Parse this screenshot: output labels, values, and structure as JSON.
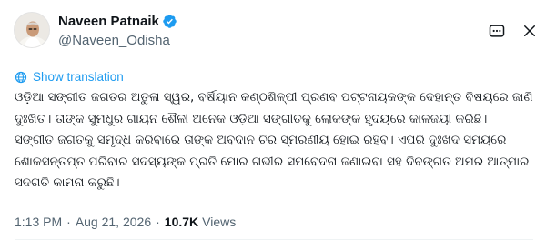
{
  "author": {
    "display_name": "Naveen Patnaik",
    "handle": "@Naveen_Odisha",
    "verified": true
  },
  "icons": {
    "avatar": "profile-photo",
    "verified": "verified-badge-icon",
    "more": "more-icon",
    "close": "close-icon",
    "translate": "globe-icon"
  },
  "colors": {
    "accent": "#1d9bf0",
    "muted_text": "#536471",
    "text": "#0f1419"
  },
  "translation": {
    "label": "Show translation"
  },
  "post": {
    "lines": [
      "ଓଡ଼ିଆ ସଙ୍ଗୀତ ଜଗତର ଅତୁଳା ସ୍ୱର, ବର୍ଷିୟାନ କଣ୍ଠଶିଳ୍ପୀ ପ୍ରଣବ ପଟ୍ଟନାୟକଙ୍କ ଦେହାନ୍ତ ବିଷୟରେ ଜାଣି ମୁଁ",
      "ଦୁଃଖିତ। ତାଙ୍କ ସୁମଧୁର ଗାୟନ ଶୈଳୀ ଅନେକ ଓଡ଼ିଆ ସଙ୍ଗୀତକୁ ଲୋକଙ୍କ ହୃଦୟରେ କାଳଜୟୀ କରିଛି।",
      "ସଙ୍ଗୀତ ଜଗତକୁ ସମୃଦ୍ଧ କରିବାରେ ତାଙ୍କ ଅବଦାନ ଚିର ସ୍ମରଣୀୟ ହୋଇ ରହିବ। ଏପରି ଦୁଃଖଦ ସମୟରେ",
      "ଶୋକସନ୍ତପ୍ତ ପରିବାର ସଦସ୍ୟଙ୍କ ପ୍ରତି ମୋର ଗଭୀର ସମବେଦନା ଜଣାଇବା ସହ ଦିବଙ୍ଗତ ଅମର ଆତ୍ମାର",
      "ସଦଗତି କାମନା କରୁଛି।"
    ]
  },
  "meta": {
    "time": "1:13 PM",
    "separator": "·",
    "date": "Aug 21, 2026",
    "views_count": "10.7K",
    "views_label": "Views"
  }
}
